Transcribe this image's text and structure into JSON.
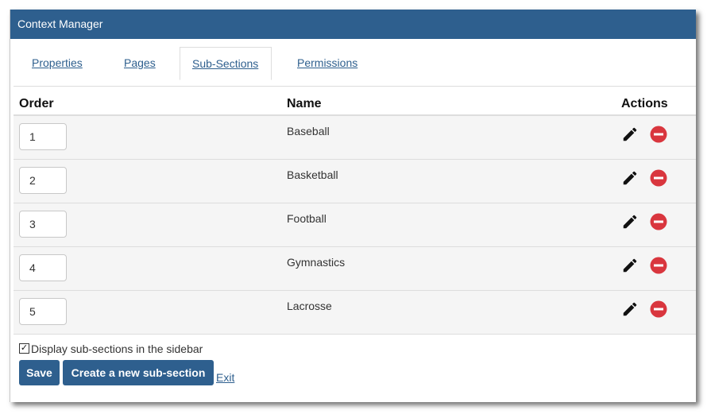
{
  "window": {
    "title": "Context Manager"
  },
  "tabs": [
    {
      "label": "Properties"
    },
    {
      "label": "Pages"
    },
    {
      "label": "Sub-Sections",
      "active": true
    },
    {
      "label": "Permissions"
    }
  ],
  "table": {
    "headers": {
      "order": "Order",
      "name": "Name",
      "actions": "Actions"
    },
    "rows": [
      {
        "order": "1",
        "name": "Baseball"
      },
      {
        "order": "2",
        "name": "Basketball"
      },
      {
        "order": "3",
        "name": "Football"
      },
      {
        "order": "4",
        "name": "Gymnastics"
      },
      {
        "order": "5",
        "name": "Lacrosse"
      }
    ],
    "action_icons": [
      "pencil-icon",
      "remove-icon"
    ]
  },
  "options": {
    "display_in_sidebar_label": "Display sub-sections in the sidebar",
    "display_in_sidebar_checked": true
  },
  "buttons": {
    "save": "Save",
    "create": "Create a new sub-section",
    "exit": "Exit"
  },
  "colors": {
    "header_bg": "#2e5f8e",
    "link": "#2e5f8e",
    "delete": "#d9363e",
    "row_bg": "#f5f5f5"
  }
}
